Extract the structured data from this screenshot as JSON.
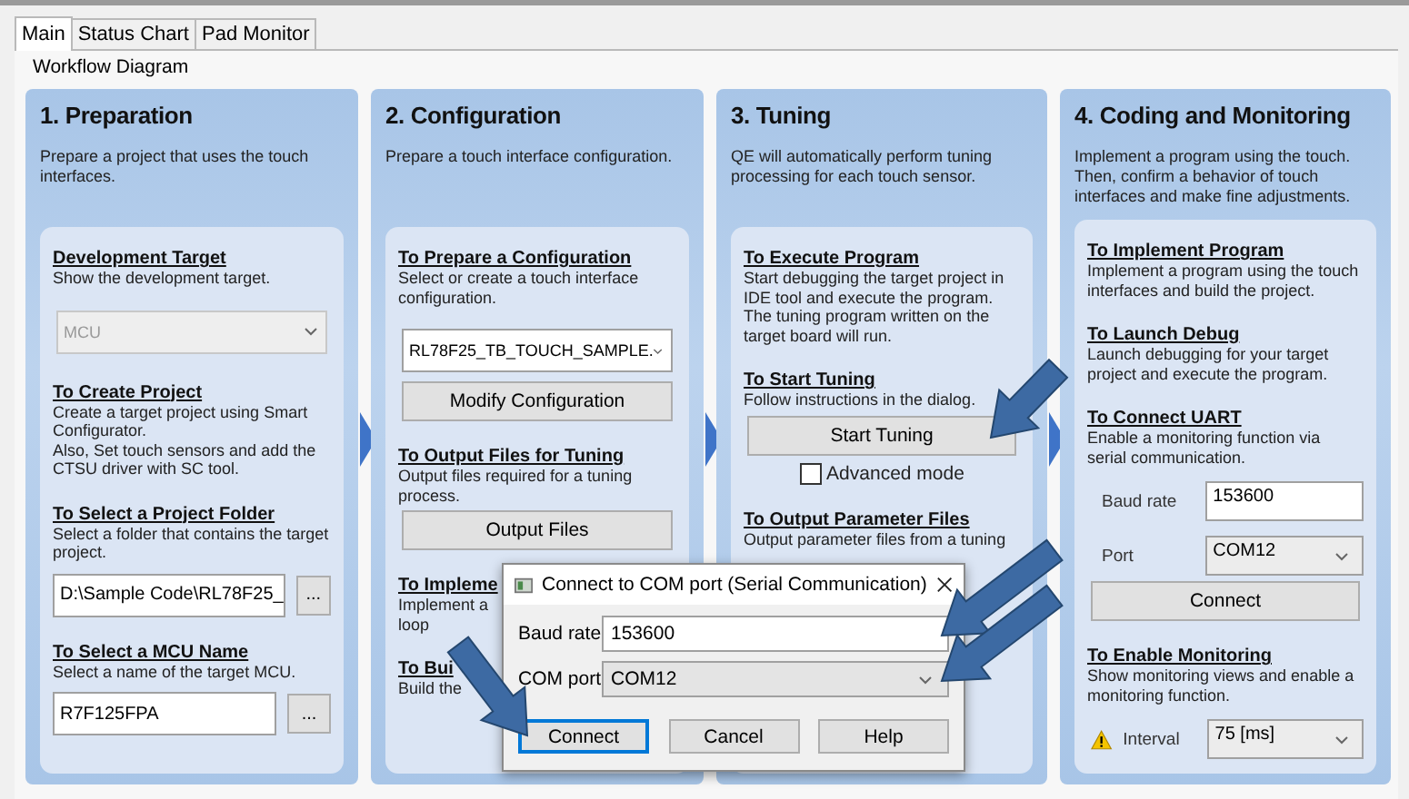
{
  "tabs": [
    {
      "label": "Main",
      "selected": true
    },
    {
      "label": "Status Chart",
      "selected": false
    },
    {
      "label": "Pad Monitor",
      "selected": false
    }
  ],
  "group_title": "Workflow Diagram",
  "columns": [
    {
      "title": "1. Preparation",
      "description": "Prepare a project that uses the touch interfaces.",
      "items": [
        {
          "kind": "heading",
          "text": "Development Target"
        },
        {
          "kind": "text",
          "text": "Show the development target."
        },
        {
          "kind": "select",
          "value": "MCU",
          "disabled": true
        },
        {
          "kind": "heading",
          "text": "To Create Project"
        },
        {
          "kind": "text",
          "text": "Create a target project using Smart Configurator."
        },
        {
          "kind": "text",
          "text": "Also, Set touch sensors and add the CTSU driver with SC tool."
        },
        {
          "kind": "heading",
          "text": "To Select a Project Folder"
        },
        {
          "kind": "text",
          "text": "Select a folder that contains the target project."
        },
        {
          "kind": "field_browse",
          "value": "D:\\Sample Code\\RL78F25_",
          "button": "..."
        },
        {
          "kind": "heading",
          "text": "To Select a MCU Name"
        },
        {
          "kind": "text",
          "text": "Select a name of the target MCU."
        },
        {
          "kind": "field_browse",
          "value": "R7F125FPA",
          "button": "..."
        }
      ]
    },
    {
      "title": "2. Configuration",
      "description": "Prepare a touch interface configuration.",
      "items": [
        {
          "kind": "heading",
          "text": "To Prepare a Configuration"
        },
        {
          "kind": "text",
          "text": "Select or create a touch interface configuration."
        },
        {
          "kind": "select",
          "value": "RL78F25_TB_TOUCH_SAMPLE.",
          "disabled": false
        },
        {
          "kind": "button",
          "label": "Modify Configuration"
        },
        {
          "kind": "heading",
          "text": "To Output Files for Tuning"
        },
        {
          "kind": "text",
          "text": "Output files required for a tuning process."
        },
        {
          "kind": "button",
          "label": "Output Files"
        },
        {
          "kind": "heading",
          "text": "To Impleme"
        },
        {
          "kind": "text",
          "text": "Implement a"
        },
        {
          "kind": "text",
          "text": "loop"
        },
        {
          "kind": "heading",
          "text": "To Bui"
        },
        {
          "kind": "text",
          "text": "Build the"
        }
      ]
    },
    {
      "title": "3. Tuning",
      "description": "QE will automatically perform tuning processing for each touch sensor.",
      "items": [
        {
          "kind": "heading",
          "text": "To Execute Program"
        },
        {
          "kind": "text",
          "text": "Start debugging the target project in IDE tool and execute the program. The tuning program written on the target board will run."
        },
        {
          "kind": "heading",
          "text": "To Start Tuning"
        },
        {
          "kind": "text",
          "text": "Follow instructions in the dialog."
        },
        {
          "kind": "button",
          "label": "Start Tuning"
        },
        {
          "kind": "checkbox",
          "label": "Advanced mode",
          "checked": false
        },
        {
          "kind": "heading",
          "text": "To Output Parameter Files"
        },
        {
          "kind": "text",
          "text": "Output parameter files from a tuning"
        }
      ]
    },
    {
      "title": "4. Coding and Monitoring",
      "description": "Implement a program using the touch. Then, confirm a behavior of touch interfaces and make fine adjustments.",
      "items": [
        {
          "kind": "heading",
          "text": "To Implement Program"
        },
        {
          "kind": "text",
          "text": "Implement a program using the touch interfaces and build the project."
        },
        {
          "kind": "heading",
          "text": "To Launch Debug"
        },
        {
          "kind": "text",
          "text": "Launch debugging for your target project and execute the program."
        },
        {
          "kind": "heading",
          "text": "To Connect UART"
        },
        {
          "kind": "text",
          "text": "Enable a monitoring function via serial communication."
        },
        {
          "kind": "field_row",
          "label": "Baud rate",
          "value": "153600"
        },
        {
          "kind": "select_row",
          "label": "Port",
          "value": "COM12",
          "warning": false
        },
        {
          "kind": "button",
          "label": "Connect"
        },
        {
          "kind": "heading",
          "text": "To Enable Monitoring"
        },
        {
          "kind": "text",
          "text": "Show monitoring views and enable a monitoring function."
        },
        {
          "kind": "select_row",
          "label": "Interval",
          "value": "75 [ms]",
          "warning": true
        }
      ]
    }
  ],
  "dialog": {
    "title": "Connect to COM port (Serial Communication)",
    "baud_label": "Baud rate",
    "baud_value": "153600",
    "port_label": "COM port",
    "port_value": "COM12",
    "buttons": [
      {
        "label": "Connect",
        "default": true
      },
      {
        "label": "Cancel",
        "default": false
      },
      {
        "label": "Help",
        "default": false
      }
    ]
  }
}
